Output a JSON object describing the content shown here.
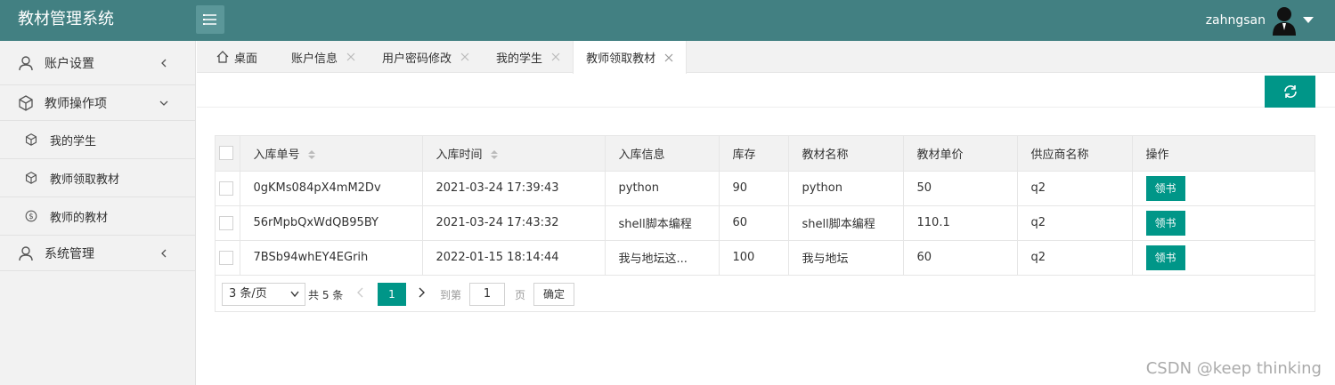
{
  "app": {
    "title": "教材管理系统"
  },
  "user": {
    "name": "zahngsan"
  },
  "sidebar": {
    "items": [
      {
        "label": "账户设置",
        "icon": "user-icon"
      },
      {
        "label": "教师操作项",
        "icon": "cube-icon"
      },
      {
        "label": "我的学生",
        "icon": "cube-icon"
      },
      {
        "label": "教师领取教材",
        "icon": "cube-icon"
      },
      {
        "label": "教师的教材",
        "icon": "dollar-circle-icon"
      },
      {
        "label": "系统管理",
        "icon": "user-icon"
      }
    ]
  },
  "tabs": [
    {
      "label": "桌面",
      "icon": "home-icon"
    },
    {
      "label": "账户信息"
    },
    {
      "label": "用户密码修改"
    },
    {
      "label": "我的学生"
    },
    {
      "label": "教师领取教材",
      "active": true
    }
  ],
  "table": {
    "columns": [
      "入库单号",
      "入库时间",
      "入库信息",
      "库存",
      "教材名称",
      "教材单价",
      "供应商名称",
      "操作"
    ],
    "rows": [
      [
        "0gKMs084pX4mM2Dv",
        "2021-03-24 17:39:43",
        "python",
        "90",
        "python",
        "50",
        "q2",
        "领书"
      ],
      [
        "56rMpbQxWdQB95BY",
        "2021-03-24 17:43:32",
        "shell脚本编程",
        "60",
        "shell脚本编程",
        "110.1",
        "q2",
        "领书"
      ],
      [
        "7BSb94whEY4EGrih",
        "2022-01-15 18:14:44",
        "我与地坛这...",
        "100",
        "我与地坛",
        "60",
        "q2",
        "领书"
      ]
    ]
  },
  "pager": {
    "page_size": "3 条/页",
    "total": "共 5 条",
    "current": "1",
    "goto_label": "到第",
    "page_input": "1",
    "unit": "页",
    "confirm": "确定"
  },
  "watermark": "CSDN @keep   thinking",
  "colors": {
    "header": "#428082",
    "accent": "#009688"
  }
}
